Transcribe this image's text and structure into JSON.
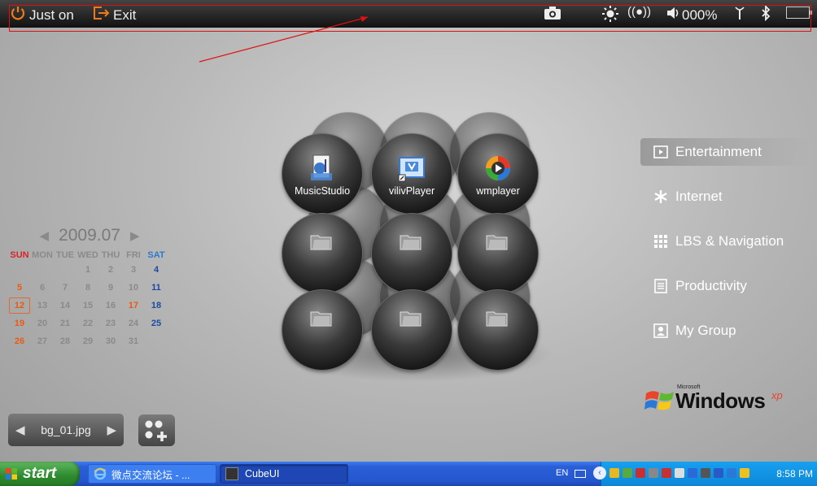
{
  "topbar": {
    "just_on_label": "Just on",
    "exit_label": "Exit",
    "volume_text": "000%"
  },
  "calendar": {
    "year_month": "2009.07",
    "weekdays": [
      "SUN",
      "MON",
      "TUE",
      "WED",
      "THU",
      "FRI",
      "SAT"
    ],
    "weeks": [
      [
        "",
        "",
        "",
        "1",
        "2",
        "3",
        "4"
      ],
      [
        "5",
        "6",
        "7",
        "8",
        "9",
        "10",
        "11"
      ],
      [
        "12",
        "13",
        "14",
        "15",
        "16",
        "17",
        "18"
      ],
      [
        "19",
        "20",
        "21",
        "22",
        "23",
        "24",
        "25"
      ],
      [
        "26",
        "27",
        "28",
        "29",
        "30",
        "31",
        ""
      ]
    ],
    "today": "12",
    "highlighted": [
      "17"
    ]
  },
  "wallpaper": {
    "filename": "bg_01.jpg"
  },
  "apps": [
    {
      "label": "MusicStudio",
      "icon": "music-studio-icon"
    },
    {
      "label": "vilivPlayer",
      "icon": "viliv-player-icon"
    },
    {
      "label": "wmplayer",
      "icon": "windows-media-player-icon"
    }
  ],
  "menu": [
    {
      "label": "Entertainment",
      "icon": "film-icon",
      "active": true
    },
    {
      "label": "Internet",
      "icon": "asterisk-icon",
      "active": false
    },
    {
      "label": "LBS & Navigation",
      "icon": "grid-icon",
      "active": false
    },
    {
      "label": "Productivity",
      "icon": "document-icon",
      "active": false
    },
    {
      "label": "My Group",
      "icon": "person-icon",
      "active": false
    }
  ],
  "logo": {
    "brand_small": "Microsoft",
    "brand": "Windows",
    "suffix": "xp"
  },
  "taskbar": {
    "start_label": "start",
    "tasks": [
      {
        "label": "微点交流论坛 - ..."
      },
      {
        "label": "CubeUI"
      }
    ],
    "lang": "EN",
    "clock": "8:58 PM"
  },
  "colors": {
    "accent_orange": "#f07a1a",
    "sunday_red": "#d8242a",
    "saturday_blue": "#2a7ad0",
    "taskbar_blue": "#2456cf",
    "start_green": "#2e8a2e"
  }
}
